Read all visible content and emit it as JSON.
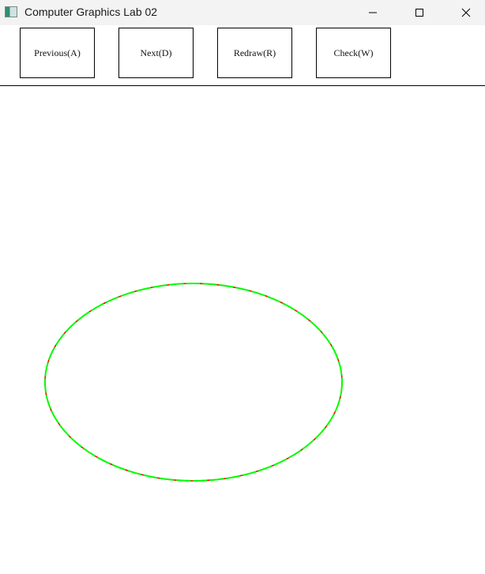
{
  "window": {
    "title": "Computer Graphics Lab 02",
    "icon": "app-window-icon",
    "controls": [
      "minimize-icon",
      "maximize-icon",
      "close-icon"
    ]
  },
  "toolbar": {
    "buttons": [
      {
        "label": "Previous(A)"
      },
      {
        "label": "Next(D)"
      },
      {
        "label": "Redraw(R)"
      },
      {
        "label": "Check(W)"
      }
    ]
  },
  "canvas": {
    "shape": "ellipse",
    "reference_color": "#ff0000",
    "rasterized_color": "#00ff00"
  }
}
